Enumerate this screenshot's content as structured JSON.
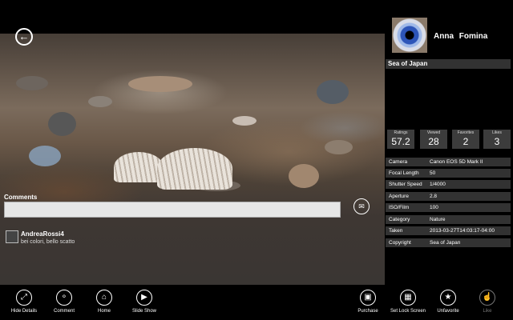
{
  "photo": {
    "title": "Sea of Japan"
  },
  "author": {
    "name": "Anna  Fomina"
  },
  "stats": [
    {
      "label": "Ratings",
      "value": "57.2"
    },
    {
      "label": "Viewed",
      "value": "28"
    },
    {
      "label": "Favorites",
      "value": "2"
    },
    {
      "label": "Likes",
      "value": "3"
    }
  ],
  "properties": [
    {
      "label": "Camera",
      "value": "Canon EOS 5D Mark II"
    },
    {
      "label": "Focal Length",
      "value": "50"
    },
    {
      "label": "Shutter Speed",
      "value": "1/4000"
    },
    {
      "label": "Aperture",
      "value": "2.8"
    },
    {
      "label": "ISO/Film",
      "value": "100"
    },
    {
      "label": "Category",
      "value": "Nature"
    },
    {
      "label": "Taken",
      "value": "2013-03-27T14:03:17-04:00"
    },
    {
      "label": "Copyright",
      "value": "Sea of Japan"
    }
  ],
  "comments": {
    "label": "Comments",
    "input_value": "",
    "items": [
      {
        "user": "AndreaRossi4",
        "text": "bei colori, bello scatto"
      }
    ]
  },
  "appbar": {
    "hide_details": "Hide Details",
    "comment": "Comment",
    "home": "Home",
    "slide_show": "Slide Show",
    "purchase": "Purchase",
    "set_lock_screen": "Set Lock Screen",
    "unfavorite": "Unfavorite",
    "like": "Like"
  },
  "icons": {
    "back": "back-arrow-icon",
    "send": "send-comment-icon",
    "hide_details": "fullscreen-icon",
    "comment": "speech-bubble-icon",
    "home": "home-icon",
    "slide_show": "play-icon",
    "purchase": "shopping-bag-icon",
    "set_lock_screen": "lock-screen-icon",
    "unfavorite": "star-icon",
    "like": "thumbs-up-icon"
  },
  "colors": {
    "background": "#000000",
    "panel_row": "#323232",
    "stat_tile": "#3c3c3c",
    "comment_input": "#e6e6e6"
  }
}
